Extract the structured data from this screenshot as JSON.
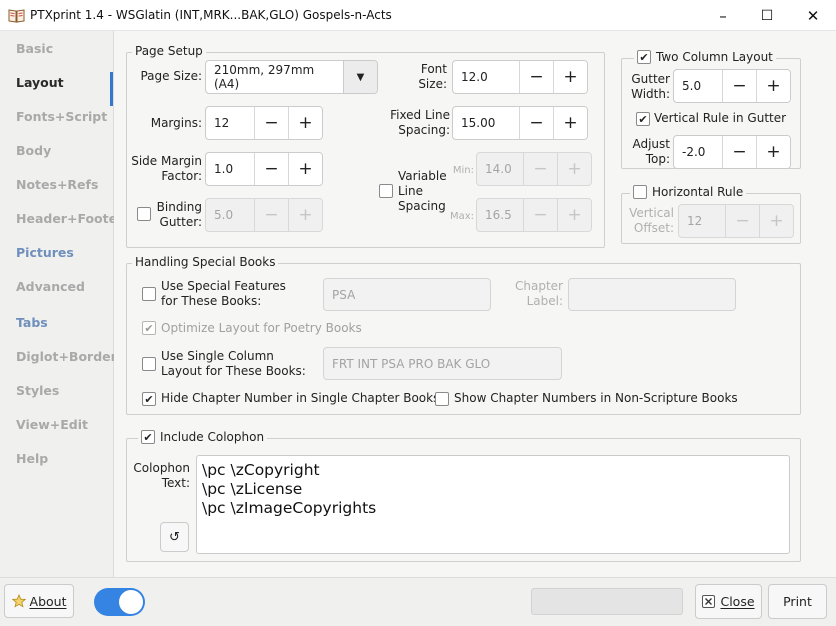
{
  "window": {
    "title": "PTXprint 1.4  -  WSGlatin (INT,MRK...BAK,GLO) Gospels-n-Acts",
    "app_icon": "book-icon",
    "minimize": "–",
    "maximize": "☐",
    "close": "✕"
  },
  "sidebar": {
    "items": [
      {
        "label": "Basic",
        "state": "disabled"
      },
      {
        "label": "Layout",
        "state": "active"
      },
      {
        "label": "Fonts+Script",
        "state": "disabled"
      },
      {
        "label": "Body",
        "state": "disabled"
      },
      {
        "label": "Notes+Refs",
        "state": "disabled"
      },
      {
        "label": "Header+Footer",
        "state": "disabled"
      },
      {
        "label": "Pictures",
        "state": "enabled"
      },
      {
        "label": "Advanced",
        "state": "disabled"
      },
      {
        "label": "Tabs",
        "state": "enabled"
      },
      {
        "label": "Diglot+Border",
        "state": "disabled"
      },
      {
        "label": "Styles",
        "state": "disabled"
      },
      {
        "label": "View+Edit",
        "state": "disabled"
      },
      {
        "label": "Help",
        "state": "disabled"
      }
    ]
  },
  "page_setup": {
    "legend": "Page Setup",
    "page_size": {
      "label": "Page Size:",
      "value": "210mm, 297mm (A4)"
    },
    "margins": {
      "label": "Margins:",
      "value": "12"
    },
    "side_margin": {
      "label1": "Side Margin",
      "label2": "Factor:",
      "value": "1.0"
    },
    "binding_gutter": {
      "label1": "Binding",
      "label2": "Gutter:",
      "value": "5.0",
      "checked": false
    },
    "font_size": {
      "label1": "Font",
      "label2": "Size:",
      "value": "12.0"
    },
    "fixed_line": {
      "label1": "Fixed Line",
      "label2": "Spacing:",
      "value": "15.00"
    },
    "variable_line": {
      "label1": "Variable",
      "label2": "Line",
      "label3": "Spacing",
      "checked": false
    },
    "min": {
      "label": "Min:",
      "value": "14.0"
    },
    "max": {
      "label": "Max:",
      "value": "16.5"
    }
  },
  "two_column": {
    "label": "Two Column Layout",
    "checked": true,
    "gutter_width": {
      "label1": "Gutter",
      "label2": "Width:",
      "value": "5.0"
    },
    "vertical_rule": {
      "label": "Vertical Rule in Gutter",
      "checked": true
    },
    "adjust_top": {
      "label1": "Adjust",
      "label2": "Top:",
      "value": "-2.0"
    }
  },
  "horizontal_rule": {
    "label": "Horizontal Rule",
    "checked": false,
    "vertical_offset": {
      "label1": "Vertical",
      "label2": "Offset:",
      "value": "12"
    }
  },
  "special_books": {
    "legend": "Handling Special Books",
    "special_features": {
      "label1": "Use Special Features",
      "label2": "for These Books:",
      "checked": false,
      "value": "PSA"
    },
    "chapter_label": {
      "label1": "Chapter",
      "label2": "Label:",
      "value": ""
    },
    "optimize_poetry": {
      "label": "Optimize Layout for Poetry Books",
      "checked": true
    },
    "single_column": {
      "label1": "Use Single Column",
      "label2": "Layout for These Books:",
      "checked": false,
      "value": "FRT INT PSA PRO BAK GLO"
    },
    "hide_chapter": {
      "label": "Hide Chapter Number in Single Chapter Books",
      "checked": true
    },
    "show_chapter_nonscripture": {
      "label": "Show Chapter Numbers in Non-Scripture Books",
      "checked": false
    }
  },
  "colophon": {
    "label": "Include Colophon",
    "checked": true,
    "text_label1": "Colophon",
    "text_label2": "Text:",
    "lines": [
      "\\pc \\zCopyright",
      "\\pc \\zLicense",
      "\\pc \\zImageCopyrights"
    ],
    "reset_icon": "↺"
  },
  "footer": {
    "about_label": "About",
    "about_icon": "star-icon",
    "toggle_on": true,
    "close_label": "Close",
    "close_icon": "close-icon",
    "print_label": "Print"
  },
  "colors": {
    "accent": "#3479cf",
    "toggle": "#3584e4"
  }
}
